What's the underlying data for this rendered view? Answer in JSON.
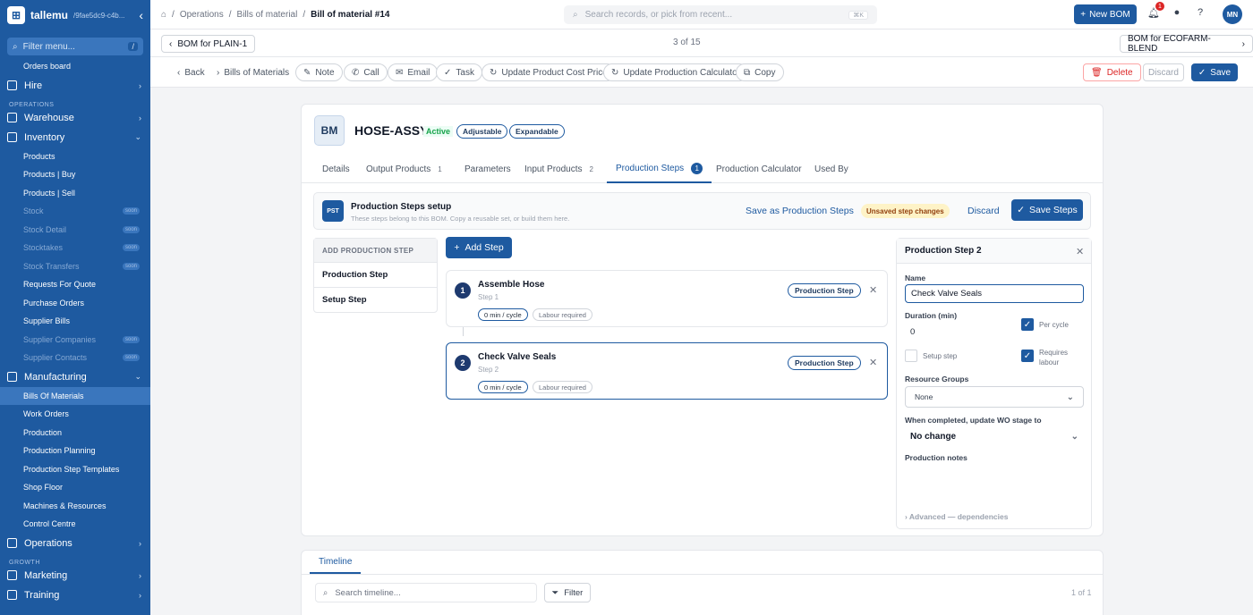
{
  "sidebar": {
    "brand": "tallemu",
    "tenant": "/9fae5dc9-c4b...",
    "filter_placeholder": "Filter menu...",
    "filter_kbd": "/",
    "orders_board": "Orders board",
    "hire": "Hire",
    "group_operations": "OPERATIONS",
    "warehouse": "Warehouse",
    "inventory": "Inventory",
    "inventory_items": [
      "Products",
      "Products | Buy",
      "Products | Sell"
    ],
    "inventory_soon": [
      "Stock",
      "Stock Detail",
      "Stocktakes",
      "Stock Transfers"
    ],
    "inventory_more": [
      "Requests For Quote",
      "Purchase Orders",
      "Supplier Bills"
    ],
    "inventory_soon2": [
      "Supplier Companies",
      "Supplier Contacts"
    ],
    "soon": "soon",
    "manufacturing": "Manufacturing",
    "manufacturing_items": [
      "Bills Of Materials",
      "Work Orders",
      "Production",
      "Production Planning",
      "Production Step Templates",
      "Shop Floor",
      "Machines & Resources",
      "Control Centre"
    ],
    "operations": "Operations",
    "group_growth": "GROWTH",
    "marketing": "Marketing",
    "training": "Training"
  },
  "topbar": {
    "crumbs": [
      "Operations",
      "Bills of material",
      "Bill of material #14"
    ],
    "search_placeholder": "Search records, or pick from recent...",
    "search_kbd": "⌘K",
    "new_bom": "New BOM",
    "notif_count": "1",
    "avatar": "MN"
  },
  "recnav": {
    "prev": "BOM for PLAIN-1",
    "position": "3 of 15",
    "next": "BOM for ECOFARM-BLEND"
  },
  "actions": {
    "back": "Back",
    "crumb": "Bills of Materials",
    "note": "Note",
    "call": "Call",
    "email": "Email",
    "task": "Task",
    "update_cost": "Update Product Cost Price",
    "update_calc": "Update Production Calculator",
    "copy": "Copy",
    "delete": "Delete",
    "discard": "Discard",
    "save": "Save"
  },
  "record": {
    "badge": "BM",
    "title": "HOSE-ASSY",
    "status": "Active",
    "tag1": "Adjustable",
    "tag2": "Expandable"
  },
  "tabs": [
    {
      "label": "Details",
      "count": ""
    },
    {
      "label": "Output Products",
      "count": "1"
    },
    {
      "label": "Parameters",
      "count": ""
    },
    {
      "label": "Input Products",
      "count": "2"
    },
    {
      "label": "Production Steps",
      "count": "1"
    },
    {
      "label": "Production Calculator",
      "count": ""
    },
    {
      "label": "Used By",
      "count": ""
    }
  ],
  "setup": {
    "badge": "PST",
    "title": "Production Steps setup",
    "subtitle": "These steps belong to this BOM. Copy a reusable set, or build them here.",
    "save_as": "Save as Production Steps",
    "unsaved": "Unsaved step changes",
    "discard": "Discard",
    "save_steps": "Save Steps"
  },
  "addmenu": {
    "header": "ADD PRODUCTION STEP",
    "items": [
      "Production Step",
      "Setup Step"
    ]
  },
  "add_step": "Add Step",
  "steps": [
    {
      "num": "1",
      "title": "Assemble Hose",
      "sub": "Step 1",
      "duration": "0 min / cycle",
      "labour": "Labour required",
      "tag": "Production Step"
    },
    {
      "num": "2",
      "title": "Check Valve Seals",
      "sub": "Step 2",
      "duration": "0 min / cycle",
      "labour": "Labour required",
      "tag": "Production Step"
    }
  ],
  "panel": {
    "title": "Production Step 2",
    "name_label": "Name",
    "name_value": "Check Valve Seals",
    "duration_label": "Duration (min)",
    "duration_value": "0",
    "per_cycle": "Per cycle",
    "setup_step": "Setup step",
    "requires_labour": "Requires labour",
    "resource_label": "Resource Groups",
    "resource_value": "None",
    "wo_label": "When completed, update WO stage to",
    "wo_value": "No change",
    "notes_label": "Production notes",
    "advanced": "Advanced — dependencies"
  },
  "timeline": {
    "tab": "Timeline",
    "search_placeholder": "Search timeline...",
    "filter": "Filter",
    "count": "1 of 1"
  }
}
